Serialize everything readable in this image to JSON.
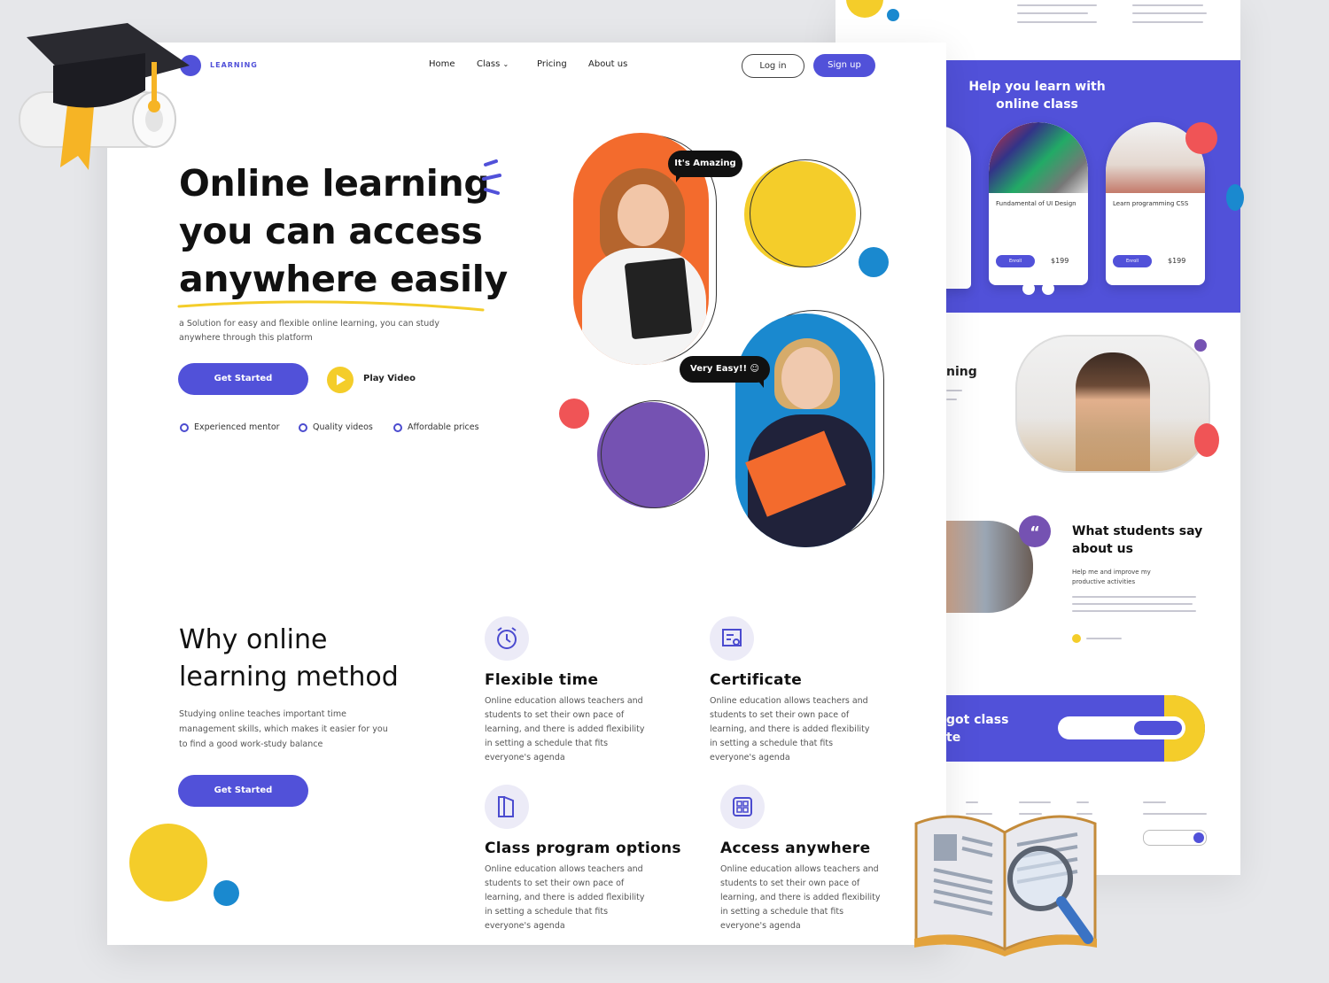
{
  "brand": {
    "logo_text": "LEARNING",
    "accent_color": "#5151d9",
    "yellow": "#f4cd2a",
    "orange": "#f36b2d",
    "blue": "#1a89cf",
    "purple": "#7552b2",
    "red": "#f05456"
  },
  "nav": {
    "links": [
      "Home",
      "Class",
      "Pricing",
      "About us"
    ],
    "login_label": "Log in",
    "signup_label": "Sign up"
  },
  "hero": {
    "title_line1": "Online learning",
    "title_line2": "you can access",
    "title_line3": "anywhere easily",
    "subtitle": "a Solution for easy and flexible online learning, you can study anywhere through this platform",
    "get_started_label": "Get Started",
    "play_video_label": "Play Video",
    "checks": [
      "Experienced mentor",
      "Quality videos",
      "Affordable prices"
    ],
    "bubble_1": "It's Amazing",
    "bubble_2": "Very Easy!! ☺"
  },
  "why": {
    "title_line1": "Why online",
    "title_line2": "learning method",
    "description": "Studying online teaches important time management skills, which makes it easier for you to find a good work-study balance",
    "get_started_label": "Get Started",
    "features": [
      {
        "icon": "alarm-clock-icon",
        "title": "Flexible time",
        "desc": "Online education allows teachers and students to set their own pace of learning, and there is added flexibility in setting a schedule that fits everyone's agenda"
      },
      {
        "icon": "certificate-icon",
        "title": "Certificate",
        "desc": "Online education allows teachers and students to set their own pace of learning, and there is added flexibility in setting a schedule that fits everyone's agenda"
      },
      {
        "icon": "book-pages-icon",
        "title": "Class program options",
        "desc": "Online education allows teachers and students to set their own pace of learning, and there is added flexibility in setting a schedule that fits everyone's agenda"
      },
      {
        "icon": "devices-icon",
        "title": "Access anywhere",
        "desc": "Online education allows teachers and students to set their own pace of learning, and there is added flexibility in setting a schedule that fits everyone's agenda"
      }
    ]
  },
  "back_page": {
    "promo_title": "Help you learn with online class",
    "courses": [
      {
        "title": "Fundamental of UI Design",
        "price": "$199"
      },
      {
        "title": "Learn programming CSS",
        "price": "$199"
      }
    ],
    "section_partial": "ning",
    "testimonial_title": "What students say about us",
    "testimonial_sub": "Help me and improve my productive activities",
    "cta_partial": "got class",
    "cta_partial_2": "te"
  }
}
